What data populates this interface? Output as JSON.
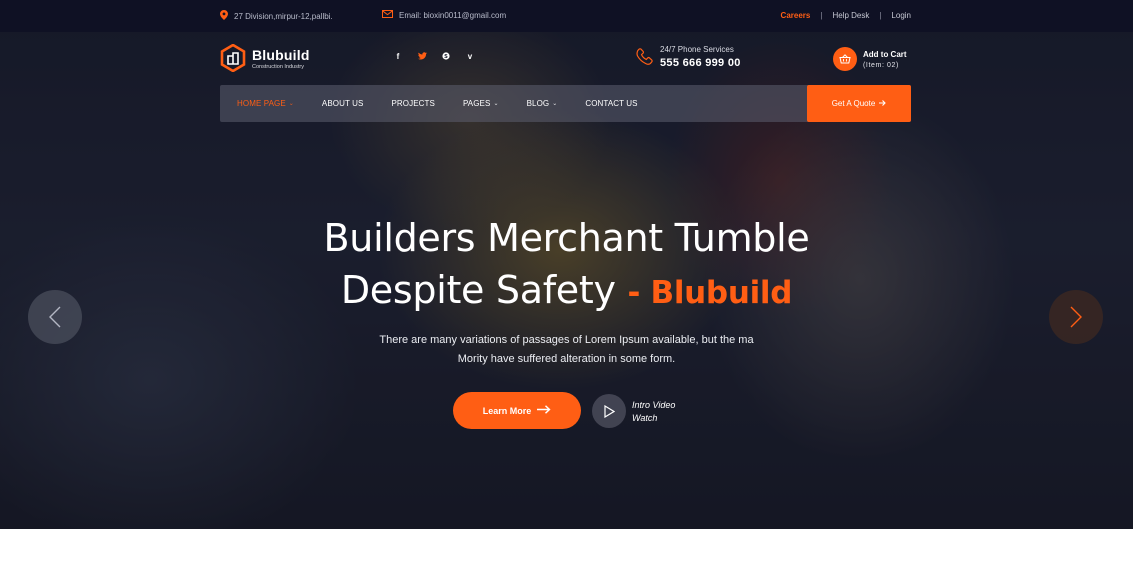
{
  "topbar": {
    "address": "27 Division,mirpur-12,pallbi.",
    "email": "Email: bioxin0011@gmail.com",
    "links": [
      "Careers",
      "Help Desk",
      "Login"
    ],
    "separator": "|"
  },
  "header": {
    "logo_name": "Blubuild",
    "logo_sub": "Construction Industry",
    "socials": [
      "facebook-icon",
      "twitter-icon",
      "skype-icon",
      "vimeo-icon"
    ],
    "phone_label": "24/7 Phone Services",
    "phone_number": "555 666 999 00",
    "cart_label": "Add to Cart",
    "cart_items": "(Item: 02)"
  },
  "nav": {
    "items": [
      {
        "label": "HOME PAGE",
        "dropdown": true
      },
      {
        "label": "ABOUT US",
        "dropdown": false
      },
      {
        "label": "PROJECTS",
        "dropdown": false
      },
      {
        "label": "PAGES",
        "dropdown": true
      },
      {
        "label": "BLOG",
        "dropdown": true
      },
      {
        "label": "CONTACT US",
        "dropdown": false
      }
    ],
    "quote_label": "Get A Quote"
  },
  "hero": {
    "title_line1": "Builders Merchant Tumble",
    "title_line2": "Despite Safety",
    "title_accent": "- Blubuild",
    "desc_line1": "There are many variations of passages of Lorem Ipsum available, but the ma",
    "desc_line2": "Mority have suffered alteration in some form.",
    "cta_label": "Learn More",
    "video_line1": "Intro Video",
    "video_line2": "Watch"
  },
  "colors": {
    "accent": "#ff5e14",
    "topbar": "#0f1124"
  }
}
